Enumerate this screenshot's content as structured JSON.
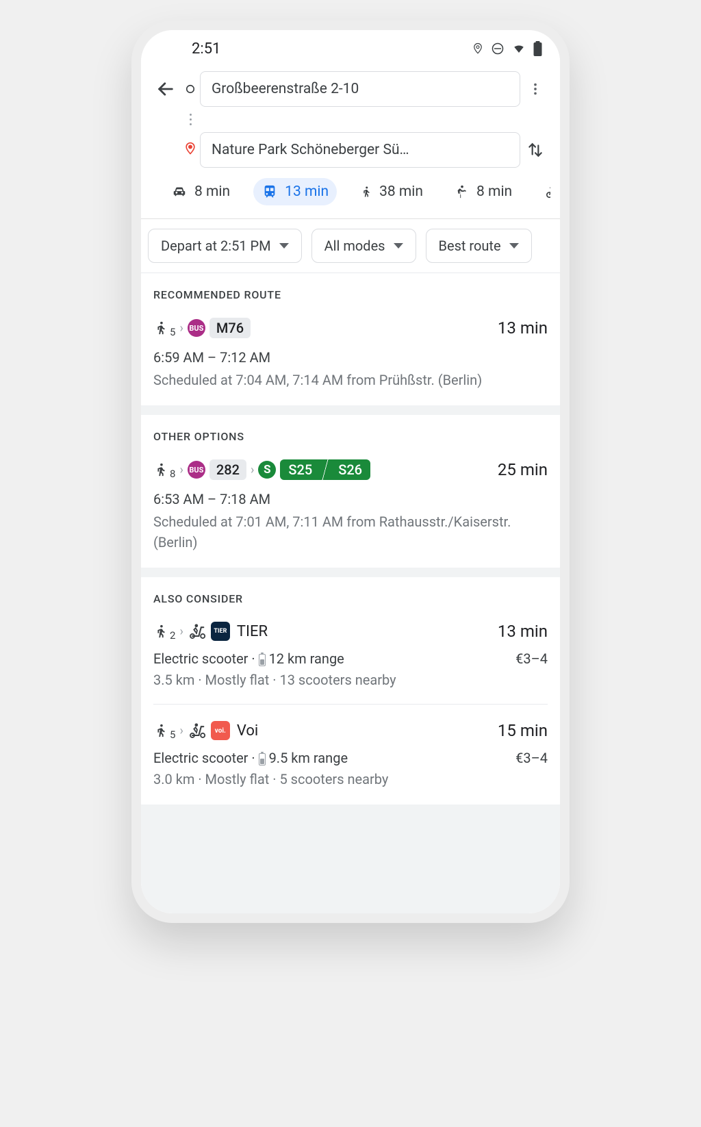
{
  "statusbar": {
    "time": "2:51"
  },
  "header": {
    "origin": "Großbeerenstraße 2-10",
    "destination": "Nature Park Schöneberger Sü…"
  },
  "modes": {
    "car": "8 min",
    "transit": "13 min",
    "walk": "38 min",
    "ride": "8 min",
    "bike": ""
  },
  "filters": {
    "depart": "Depart at 2:51 PM",
    "modes": "All modes",
    "pref": "Best route"
  },
  "sections": {
    "recommended": "RECOMMENDED ROUTE",
    "other": "OTHER OPTIONS",
    "also": "ALSO CONSIDER"
  },
  "routes": {
    "r1": {
      "walk_min": "5",
      "bus_label": "BUS",
      "line": "M76",
      "duration": "13 min",
      "times": "6:59 AM – 7:12 AM",
      "detail": "Scheduled at 7:04 AM, 7:14 AM from Prühßstr. (Berlin)"
    },
    "r2": {
      "walk_min": "8",
      "bus_label": "BUS",
      "line": "282",
      "sbahn1": "S25",
      "sbahn2": "S26",
      "duration": "25 min",
      "times": "6:53 AM – 7:18 AM",
      "detail": "Scheduled at 7:01 AM, 7:11 AM from Rathausstr./Kaiserstr. (Berlin)"
    },
    "r3": {
      "walk_min": "2",
      "brand": "TIER",
      "duration": "13 min",
      "line1a": "Electric scooter · ",
      "line1b": " 12 km range",
      "price": "€3–4",
      "line2": "3.5 km · Mostly flat · 13 scooters nearby"
    },
    "r4": {
      "walk_min": "5",
      "brand": "Voi",
      "duration": "15 min",
      "line1a": "Electric scooter · ",
      "line1b": " 9.5 km range",
      "price": "€3–4",
      "line2": "3.0 km · Mostly flat · 5 scooters nearby"
    }
  }
}
